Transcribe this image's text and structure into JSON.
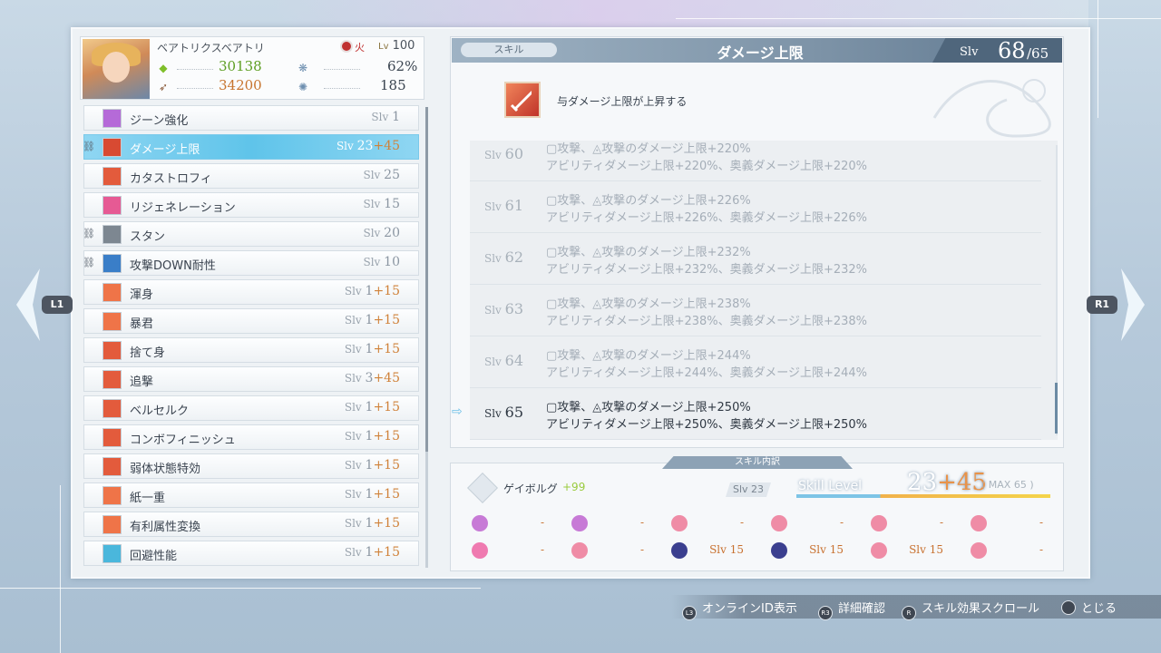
{
  "character": {
    "name": "ベアトリクスベアトリ",
    "element": "火",
    "level_prefix": "Lv",
    "level": "100",
    "hp": "30138",
    "atk": "34200",
    "stat3": "62%",
    "stat4": "185"
  },
  "skills": [
    {
      "name": "ジーン強化",
      "slv_label": "Slv",
      "base": "1",
      "plus": "",
      "icon_color": "#b56ad8",
      "selected": false,
      "locked": false
    },
    {
      "name": "ダメージ上限",
      "slv_label": "Slv",
      "base": "23",
      "plus": "+45",
      "icon_color": "#d84a32",
      "selected": true,
      "locked": true
    },
    {
      "name": "カタストロフィ",
      "slv_label": "Slv",
      "base": "25",
      "plus": "",
      "icon_color": "#e35b3c",
      "selected": false,
      "locked": false
    },
    {
      "name": "リジェネレーション",
      "slv_label": "Slv",
      "base": "15",
      "plus": "",
      "icon_color": "#e65a94",
      "selected": false,
      "locked": false
    },
    {
      "name": "スタン",
      "slv_label": "Slv",
      "base": "20",
      "plus": "",
      "icon_color": "#7d8791",
      "selected": false,
      "locked": true
    },
    {
      "name": "攻撃DOWN耐性",
      "slv_label": "Slv",
      "base": "10",
      "plus": "",
      "icon_color": "#3a7ec8",
      "selected": false,
      "locked": true
    },
    {
      "name": "渾身",
      "slv_label": "Slv",
      "base": "1",
      "plus": "+15",
      "icon_color": "#ef7448",
      "selected": false,
      "locked": false
    },
    {
      "name": "暴君",
      "slv_label": "Slv",
      "base": "1",
      "plus": "+15",
      "icon_color": "#ef7448",
      "selected": false,
      "locked": false
    },
    {
      "name": "捨て身",
      "slv_label": "Slv",
      "base": "1",
      "plus": "+15",
      "icon_color": "#e35b3c",
      "selected": false,
      "locked": false
    },
    {
      "name": "追撃",
      "slv_label": "Slv",
      "base": "3",
      "plus": "+45",
      "icon_color": "#e35b3c",
      "selected": false,
      "locked": false
    },
    {
      "name": "ベルセルク",
      "slv_label": "Slv",
      "base": "1",
      "plus": "+15",
      "icon_color": "#e35b3c",
      "selected": false,
      "locked": false
    },
    {
      "name": "コンボフィニッシュ",
      "slv_label": "Slv",
      "base": "1",
      "plus": "+15",
      "icon_color": "#e35b3c",
      "selected": false,
      "locked": false
    },
    {
      "name": "弱体状態特効",
      "slv_label": "Slv",
      "base": "1",
      "plus": "+15",
      "icon_color": "#e35b3c",
      "selected": false,
      "locked": false
    },
    {
      "name": "紙一重",
      "slv_label": "Slv",
      "base": "1",
      "plus": "+15",
      "icon_color": "#ef7448",
      "selected": false,
      "locked": false
    },
    {
      "name": "有利属性変換",
      "slv_label": "Slv",
      "base": "1",
      "plus": "+15",
      "icon_color": "#ef7448",
      "selected": false,
      "locked": false
    },
    {
      "name": "回避性能",
      "slv_label": "Slv",
      "base": "1",
      "plus": "+15",
      "icon_color": "#4ab7dc",
      "selected": false,
      "locked": false
    }
  ],
  "detail": {
    "tag": "スキル",
    "title": "ダメージ上限",
    "slv_label": "Slv",
    "slv_current": "68",
    "slv_max": "/65",
    "description": "与ダメージ上限が上昇する",
    "levels": [
      {
        "label": "Slv",
        "num": "60",
        "line1": "▢攻撃、◬攻撃のダメージ上限+220%",
        "line2": "アビリティダメージ上限+220%、奥義ダメージ上限+220%",
        "current": false
      },
      {
        "label": "Slv",
        "num": "61",
        "line1": "▢攻撃、◬攻撃のダメージ上限+226%",
        "line2": "アビリティダメージ上限+226%、奥義ダメージ上限+226%",
        "current": false
      },
      {
        "label": "Slv",
        "num": "62",
        "line1": "▢攻撃、◬攻撃のダメージ上限+232%",
        "line2": "アビリティダメージ上限+232%、奥義ダメージ上限+232%",
        "current": false
      },
      {
        "label": "Slv",
        "num": "63",
        "line1": "▢攻撃、◬攻撃のダメージ上限+238%",
        "line2": "アビリティダメージ上限+238%、奥義ダメージ上限+238%",
        "current": false
      },
      {
        "label": "Slv",
        "num": "64",
        "line1": "▢攻撃、◬攻撃のダメージ上限+244%",
        "line2": "アビリティダメージ上限+244%、奥義ダメージ上限+244%",
        "current": false
      },
      {
        "label": "Slv",
        "num": "65",
        "line1": "▢攻撃、◬攻撃のダメージ上限+250%",
        "line2": "アビリティダメージ上限+250%、奥義ダメージ上限+250%",
        "current": true
      }
    ]
  },
  "breakdown": {
    "tag": "スキル内訳",
    "weapon_name": "ゲイボルグ",
    "weapon_plus": "+99",
    "weapon_slv": "Slv 23",
    "skill_level_label": "Skill Level",
    "skill_level_base": "23",
    "skill_level_plus": "+45",
    "max_text": "( MAX 65 )",
    "slots": [
      {
        "value": "-",
        "color": "#c77ad6"
      },
      {
        "value": "-",
        "color": "#c77ad6"
      },
      {
        "value": "-",
        "color": "#ef8ca6"
      },
      {
        "value": "-",
        "color": "#ef8ca6"
      },
      {
        "value": "-",
        "color": "#ef8ca6"
      },
      {
        "value": "-",
        "color": "#ef8ca6"
      },
      {
        "value": "-",
        "color": "#ef7ab0"
      },
      {
        "value": "-",
        "color": "#ef8ca6"
      },
      {
        "value": "Slv 15",
        "color": "#3b3f8f"
      },
      {
        "value": "Slv 15",
        "color": "#3b3f8f"
      },
      {
        "value": "Slv 15",
        "color": "#ef8ca6"
      },
      {
        "value": "-",
        "color": "#ef8ca6"
      }
    ]
  },
  "nav": {
    "left": "L1",
    "right": "R1"
  },
  "footer": [
    {
      "key": "L3",
      "label": "オンラインID表示"
    },
    {
      "key": "R3",
      "label": "詳細確認"
    },
    {
      "key": "R",
      "label": "スキル効果スクロール"
    },
    {
      "key": "",
      "label": "とじる"
    }
  ]
}
